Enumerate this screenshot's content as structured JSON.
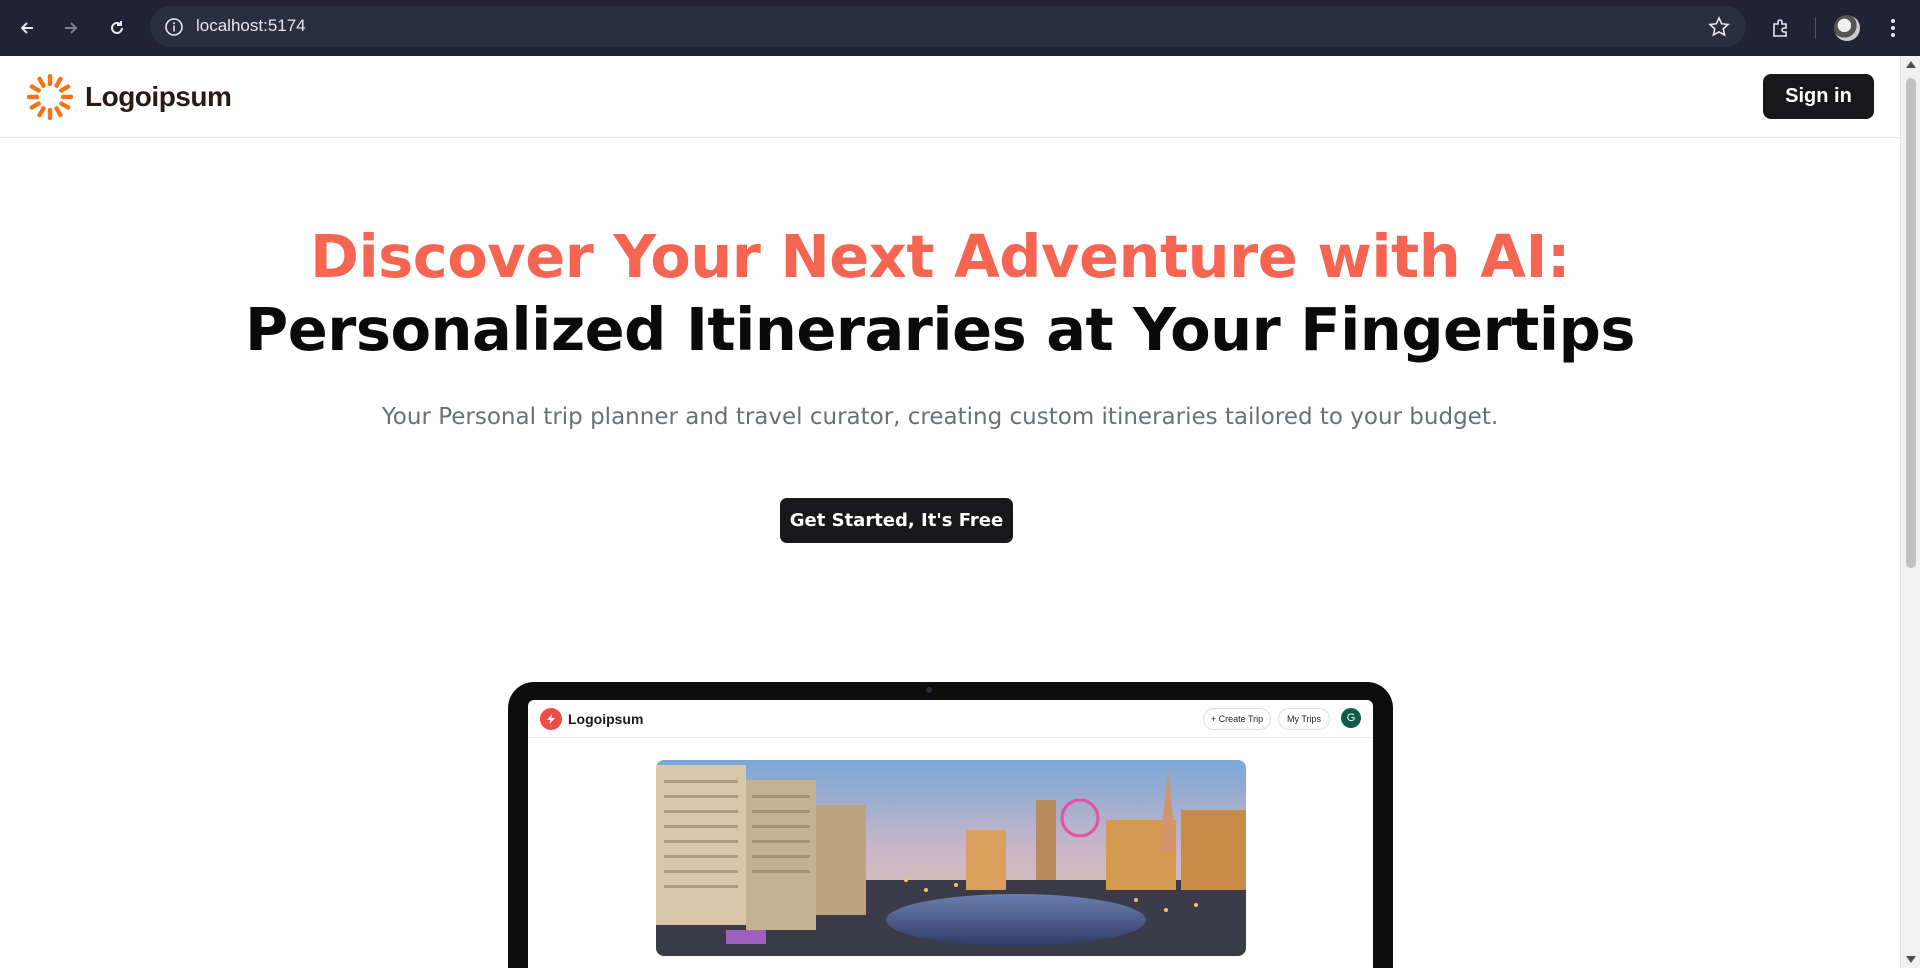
{
  "browser": {
    "url": "localhost:5174"
  },
  "header": {
    "brand_name": "Logoipsum",
    "signin_label": "Sign in"
  },
  "hero": {
    "title_line1": "Discover Your Next Adventure with AI:",
    "title_line2": "Personalized Itineraries at Your Fingertips",
    "subtitle": "Your Personal trip planner and travel curator, creating custom itineraries tailored to your budget.",
    "cta_label": "Get Started, It's Free"
  },
  "preview": {
    "brand_name": "Logoipsum",
    "create_trip_label": "+ Create Trip",
    "my_trips_label": "My Trips",
    "avatar_initial": "G"
  },
  "colors": {
    "accent": "#f56551",
    "dark_button": "#18181b",
    "brand_orange": "#f97316"
  }
}
